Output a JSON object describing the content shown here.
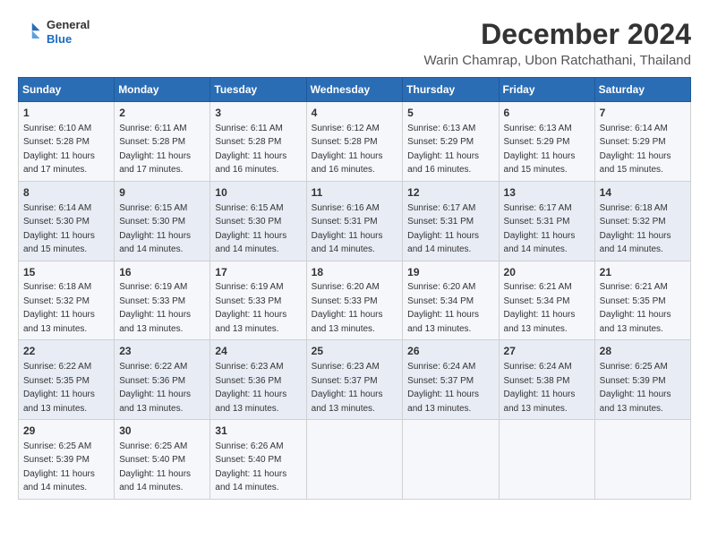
{
  "header": {
    "logo_general": "General",
    "logo_blue": "Blue",
    "main_title": "December 2024",
    "sub_title": "Warin Chamrap, Ubon Ratchathani, Thailand"
  },
  "calendar": {
    "headers": [
      "Sunday",
      "Monday",
      "Tuesday",
      "Wednesday",
      "Thursday",
      "Friday",
      "Saturday"
    ],
    "weeks": [
      [
        null,
        null,
        null,
        null,
        null,
        null,
        null
      ]
    ],
    "days": {
      "1": {
        "rise": "6:10 AM",
        "set": "5:28 PM",
        "daylight": "11 hours and 17 minutes"
      },
      "2": {
        "rise": "6:11 AM",
        "set": "5:28 PM",
        "daylight": "11 hours and 17 minutes"
      },
      "3": {
        "rise": "6:11 AM",
        "set": "5:28 PM",
        "daylight": "11 hours and 16 minutes"
      },
      "4": {
        "rise": "6:12 AM",
        "set": "5:28 PM",
        "daylight": "11 hours and 16 minutes"
      },
      "5": {
        "rise": "6:13 AM",
        "set": "5:29 PM",
        "daylight": "11 hours and 16 minutes"
      },
      "6": {
        "rise": "6:13 AM",
        "set": "5:29 PM",
        "daylight": "11 hours and 15 minutes"
      },
      "7": {
        "rise": "6:14 AM",
        "set": "5:29 PM",
        "daylight": "11 hours and 15 minutes"
      },
      "8": {
        "rise": "6:14 AM",
        "set": "5:30 PM",
        "daylight": "11 hours and 15 minutes"
      },
      "9": {
        "rise": "6:15 AM",
        "set": "5:30 PM",
        "daylight": "11 hours and 14 minutes"
      },
      "10": {
        "rise": "6:15 AM",
        "set": "5:30 PM",
        "daylight": "11 hours and 14 minutes"
      },
      "11": {
        "rise": "6:16 AM",
        "set": "5:31 PM",
        "daylight": "11 hours and 14 minutes"
      },
      "12": {
        "rise": "6:17 AM",
        "set": "5:31 PM",
        "daylight": "11 hours and 14 minutes"
      },
      "13": {
        "rise": "6:17 AM",
        "set": "5:31 PM",
        "daylight": "11 hours and 14 minutes"
      },
      "14": {
        "rise": "6:18 AM",
        "set": "5:32 PM",
        "daylight": "11 hours and 14 minutes"
      },
      "15": {
        "rise": "6:18 AM",
        "set": "5:32 PM",
        "daylight": "11 hours and 13 minutes"
      },
      "16": {
        "rise": "6:19 AM",
        "set": "5:33 PM",
        "daylight": "11 hours and 13 minutes"
      },
      "17": {
        "rise": "6:19 AM",
        "set": "5:33 PM",
        "daylight": "11 hours and 13 minutes"
      },
      "18": {
        "rise": "6:20 AM",
        "set": "5:33 PM",
        "daylight": "11 hours and 13 minutes"
      },
      "19": {
        "rise": "6:20 AM",
        "set": "5:34 PM",
        "daylight": "11 hours and 13 minutes"
      },
      "20": {
        "rise": "6:21 AM",
        "set": "5:34 PM",
        "daylight": "11 hours and 13 minutes"
      },
      "21": {
        "rise": "6:21 AM",
        "set": "5:35 PM",
        "daylight": "11 hours and 13 minutes"
      },
      "22": {
        "rise": "6:22 AM",
        "set": "5:35 PM",
        "daylight": "11 hours and 13 minutes"
      },
      "23": {
        "rise": "6:22 AM",
        "set": "5:36 PM",
        "daylight": "11 hours and 13 minutes"
      },
      "24": {
        "rise": "6:23 AM",
        "set": "5:36 PM",
        "daylight": "11 hours and 13 minutes"
      },
      "25": {
        "rise": "6:23 AM",
        "set": "5:37 PM",
        "daylight": "11 hours and 13 minutes"
      },
      "26": {
        "rise": "6:24 AM",
        "set": "5:37 PM",
        "daylight": "11 hours and 13 minutes"
      },
      "27": {
        "rise": "6:24 AM",
        "set": "5:38 PM",
        "daylight": "11 hours and 13 minutes"
      },
      "28": {
        "rise": "6:25 AM",
        "set": "5:39 PM",
        "daylight": "11 hours and 13 minutes"
      },
      "29": {
        "rise": "6:25 AM",
        "set": "5:39 PM",
        "daylight": "11 hours and 14 minutes"
      },
      "30": {
        "rise": "6:25 AM",
        "set": "5:40 PM",
        "daylight": "11 hours and 14 minutes"
      },
      "31": {
        "rise": "6:26 AM",
        "set": "5:40 PM",
        "daylight": "11 hours and 14 minutes"
      }
    }
  }
}
